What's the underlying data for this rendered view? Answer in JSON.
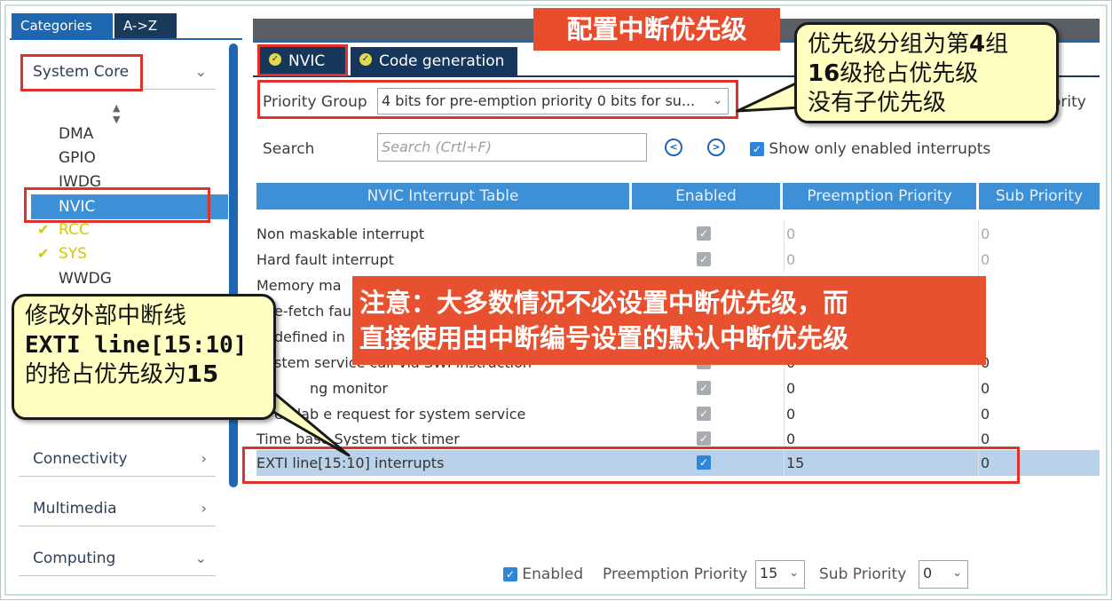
{
  "categories_tabs": {
    "categories": "Categories",
    "az": "A->Z"
  },
  "sidebar": {
    "system_core": "System Core",
    "items": [
      "DMA",
      "GPIO",
      "IWDG",
      "NVIC",
      "RCC",
      "SYS",
      "WWDG"
    ],
    "connectivity": "Connectivity",
    "multimedia": "Multimedia",
    "computing": "Computing"
  },
  "tabs": {
    "nvic": "NVIC",
    "code_generation": "Code generation"
  },
  "toolbar": {
    "priority_group_label": "Priority Group",
    "priority_group_value": "4 bits for pre-emption priority 0 bits for su...",
    "right_cut_text": "ority",
    "search_label": "Search",
    "search_placeholder": "Search (Crtl+F)",
    "show_only_enabled": "Show only enabled interrupts"
  },
  "table": {
    "headers": [
      "NVIC Interrupt Table",
      "Enabled",
      "Preemption Priority",
      "Sub Priority"
    ],
    "rows": [
      {
        "name": "Non maskable interrupt",
        "pre": "0",
        "sub": "0"
      },
      {
        "name": "Hard fault interrupt",
        "pre": "0",
        "sub": "0"
      },
      {
        "name": "Memory ma",
        "pre": "",
        "sub": ")"
      },
      {
        "name": "e-fetch fau",
        "pre": "",
        "sub": ")"
      },
      {
        "name": "defined in",
        "pre": "",
        "sub": ")"
      },
      {
        "name": "stem service call via SWI instruction",
        "pre": "0",
        "sub": "0"
      },
      {
        "name": "ng monitor",
        "pre": "0",
        "sub": "0"
      },
      {
        "name": "endab e request for system service",
        "pre": "0",
        "sub": "0"
      },
      {
        "name": "Time base System tick timer",
        "pre": "0",
        "sub": "0"
      },
      {
        "name": "EXTI line[15:10] interrupts",
        "pre": "15",
        "sub": "0"
      }
    ]
  },
  "bottom": {
    "enabled": "Enabled",
    "preemption_label": "Preemption Priority",
    "preemption_value": "15",
    "sub_label": "Sub Priority",
    "sub_value": "0"
  },
  "annotations": {
    "title": "配置中断优先级",
    "top_callout_line1": "优先级分组为第",
    "top_callout_num1": "4",
    "top_callout_suffix1": "组",
    "top_callout_num2": "16",
    "top_callout_line2": "级抢占优先级",
    "top_callout_line3": "没有子优先级",
    "note_line1": "注意：大多数情况不必设置中断优先级，而",
    "note_line2": "直接使用由中断编号设置的默认中断优先级",
    "left_callout_line1": "修改外部中断线",
    "left_callout_code": "EXTI line[15:10]",
    "left_callout_line3a": "的抢占优先级为",
    "left_callout_line3b": "15"
  },
  "colors": {
    "accent": "#1f66b0",
    "highlight": "#e0322a",
    "banner": "#e84c2d",
    "callout_bg": "#ffffc2"
  }
}
